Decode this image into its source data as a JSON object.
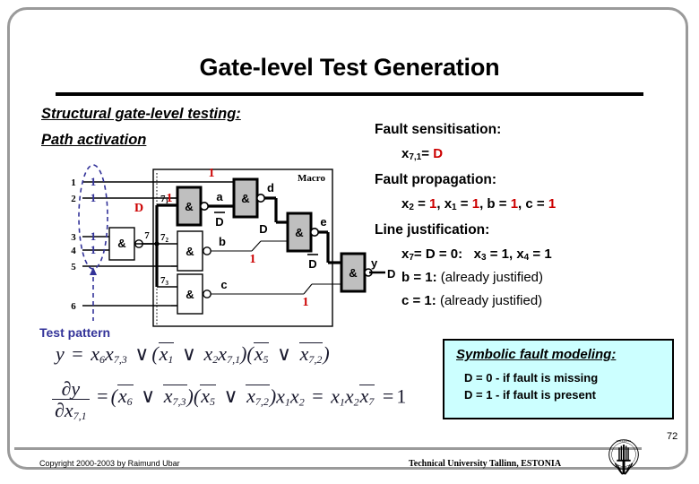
{
  "slide": {
    "title": "Gate-level Test Generation",
    "page_number": "72",
    "headings": {
      "structural": "Structural gate-level testing:",
      "path_activation": "Path activation"
    },
    "test_pattern_label": "Test pattern"
  },
  "right_column": {
    "fault_sensitisation": {
      "heading": "Fault sensitisation:",
      "value_lhs": "x",
      "value_sub": "7,1",
      "value_eq": "=",
      "value_rhs": "D"
    },
    "fault_propagation": {
      "heading": "Fault propagation:",
      "terms": [
        {
          "var": "x",
          "sub": "2",
          "val": "1"
        },
        {
          "var": "x",
          "sub": "1",
          "val": "1"
        },
        {
          "var": "b",
          "sub": "",
          "val": "1"
        },
        {
          "var": "c",
          "sub": "",
          "val": "1"
        }
      ]
    },
    "line_justification": {
      "heading": "Line justification:",
      "line1": "x7= D = 0:   x3 = 1, x4 = 1",
      "line2_lhs": "b = 1:",
      "line2_rhs": "(already justified)",
      "line3_lhs": "c = 1:",
      "line3_rhs": "(already justified)"
    }
  },
  "symbolic_box": {
    "title": "Symbolic fault modeling:",
    "line1": "D = 0  -  if fault is missing",
    "line2": "D = 1  -  if fault is present",
    "background": "#ccffff"
  },
  "formulas": {
    "line1_label": "y",
    "line2_numerator": "∂y",
    "line2_denominator": "∂x7,1"
  },
  "footer": {
    "copyright": "Copyright 2000-2003 by Raimund Ubar",
    "university": "Technical University Tallinn, ESTONIA"
  },
  "circuit": {
    "macro_label": "Macro",
    "inputs": [
      "1",
      "2",
      "3",
      "4",
      "5",
      "6"
    ],
    "test_pattern_values": [
      "1",
      "1",
      "1",
      "1"
    ],
    "fanout_label": "7",
    "fanout_branches": [
      "7",
      "7",
      "7"
    ],
    "fanout_branch_subs": [
      "1",
      "2",
      "3"
    ],
    "signal_labels": [
      "a",
      "b",
      "c",
      "d",
      "e",
      "y"
    ],
    "value_annotations": {
      "d_fault": "D",
      "gate1_in_red": "1",
      "gate2_in_red": "1",
      "bar_d_1": "D",
      "d_mid": "D",
      "bar_d_2": "D",
      "b_red": "1",
      "c_red": "1",
      "out": "D"
    }
  },
  "colors": {
    "red": "#cc0000",
    "navy": "#333399",
    "gate_gray": "#bfbfbf",
    "cyan": "#ccffff",
    "frame_gray": "#9a9a9a"
  }
}
